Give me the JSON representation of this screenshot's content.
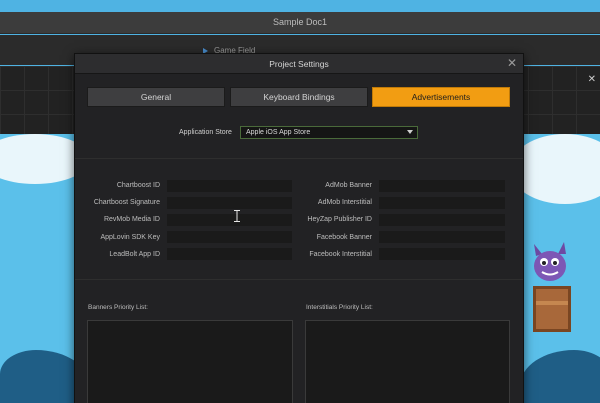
{
  "app": {
    "title": "Sample Doc1",
    "open_tab": "Game Field"
  },
  "dialog": {
    "title": "Project Settings",
    "tabs": [
      {
        "label": "General",
        "active": false
      },
      {
        "label": "Keyboard Bindings",
        "active": false
      },
      {
        "label": "Advertisements",
        "active": true
      }
    ],
    "store": {
      "label": "Application Store",
      "value": "Apple iOS App Store"
    },
    "left_fields": [
      {
        "label": "Chartboost ID",
        "value": ""
      },
      {
        "label": "Chartboost Signature",
        "value": ""
      },
      {
        "label": "RevMob Media ID",
        "value": ""
      },
      {
        "label": "AppLovin SDK Key",
        "value": ""
      },
      {
        "label": "LeadBolt App ID",
        "value": ""
      }
    ],
    "right_fields": [
      {
        "label": "AdMob Banner",
        "value": ""
      },
      {
        "label": "AdMob Interstitial",
        "value": ""
      },
      {
        "label": "HeyZap Publisher ID",
        "value": ""
      },
      {
        "label": "Facebook Banner",
        "value": ""
      },
      {
        "label": "Facebook Interstitial",
        "value": ""
      }
    ],
    "banners_list_label": "Banners Priority List:",
    "interstitials_list_label": "Interstitials Priority List:"
  },
  "colors": {
    "accent": "#f29d12",
    "dialog_bg": "#222224",
    "sky": "#5bc0ea"
  }
}
